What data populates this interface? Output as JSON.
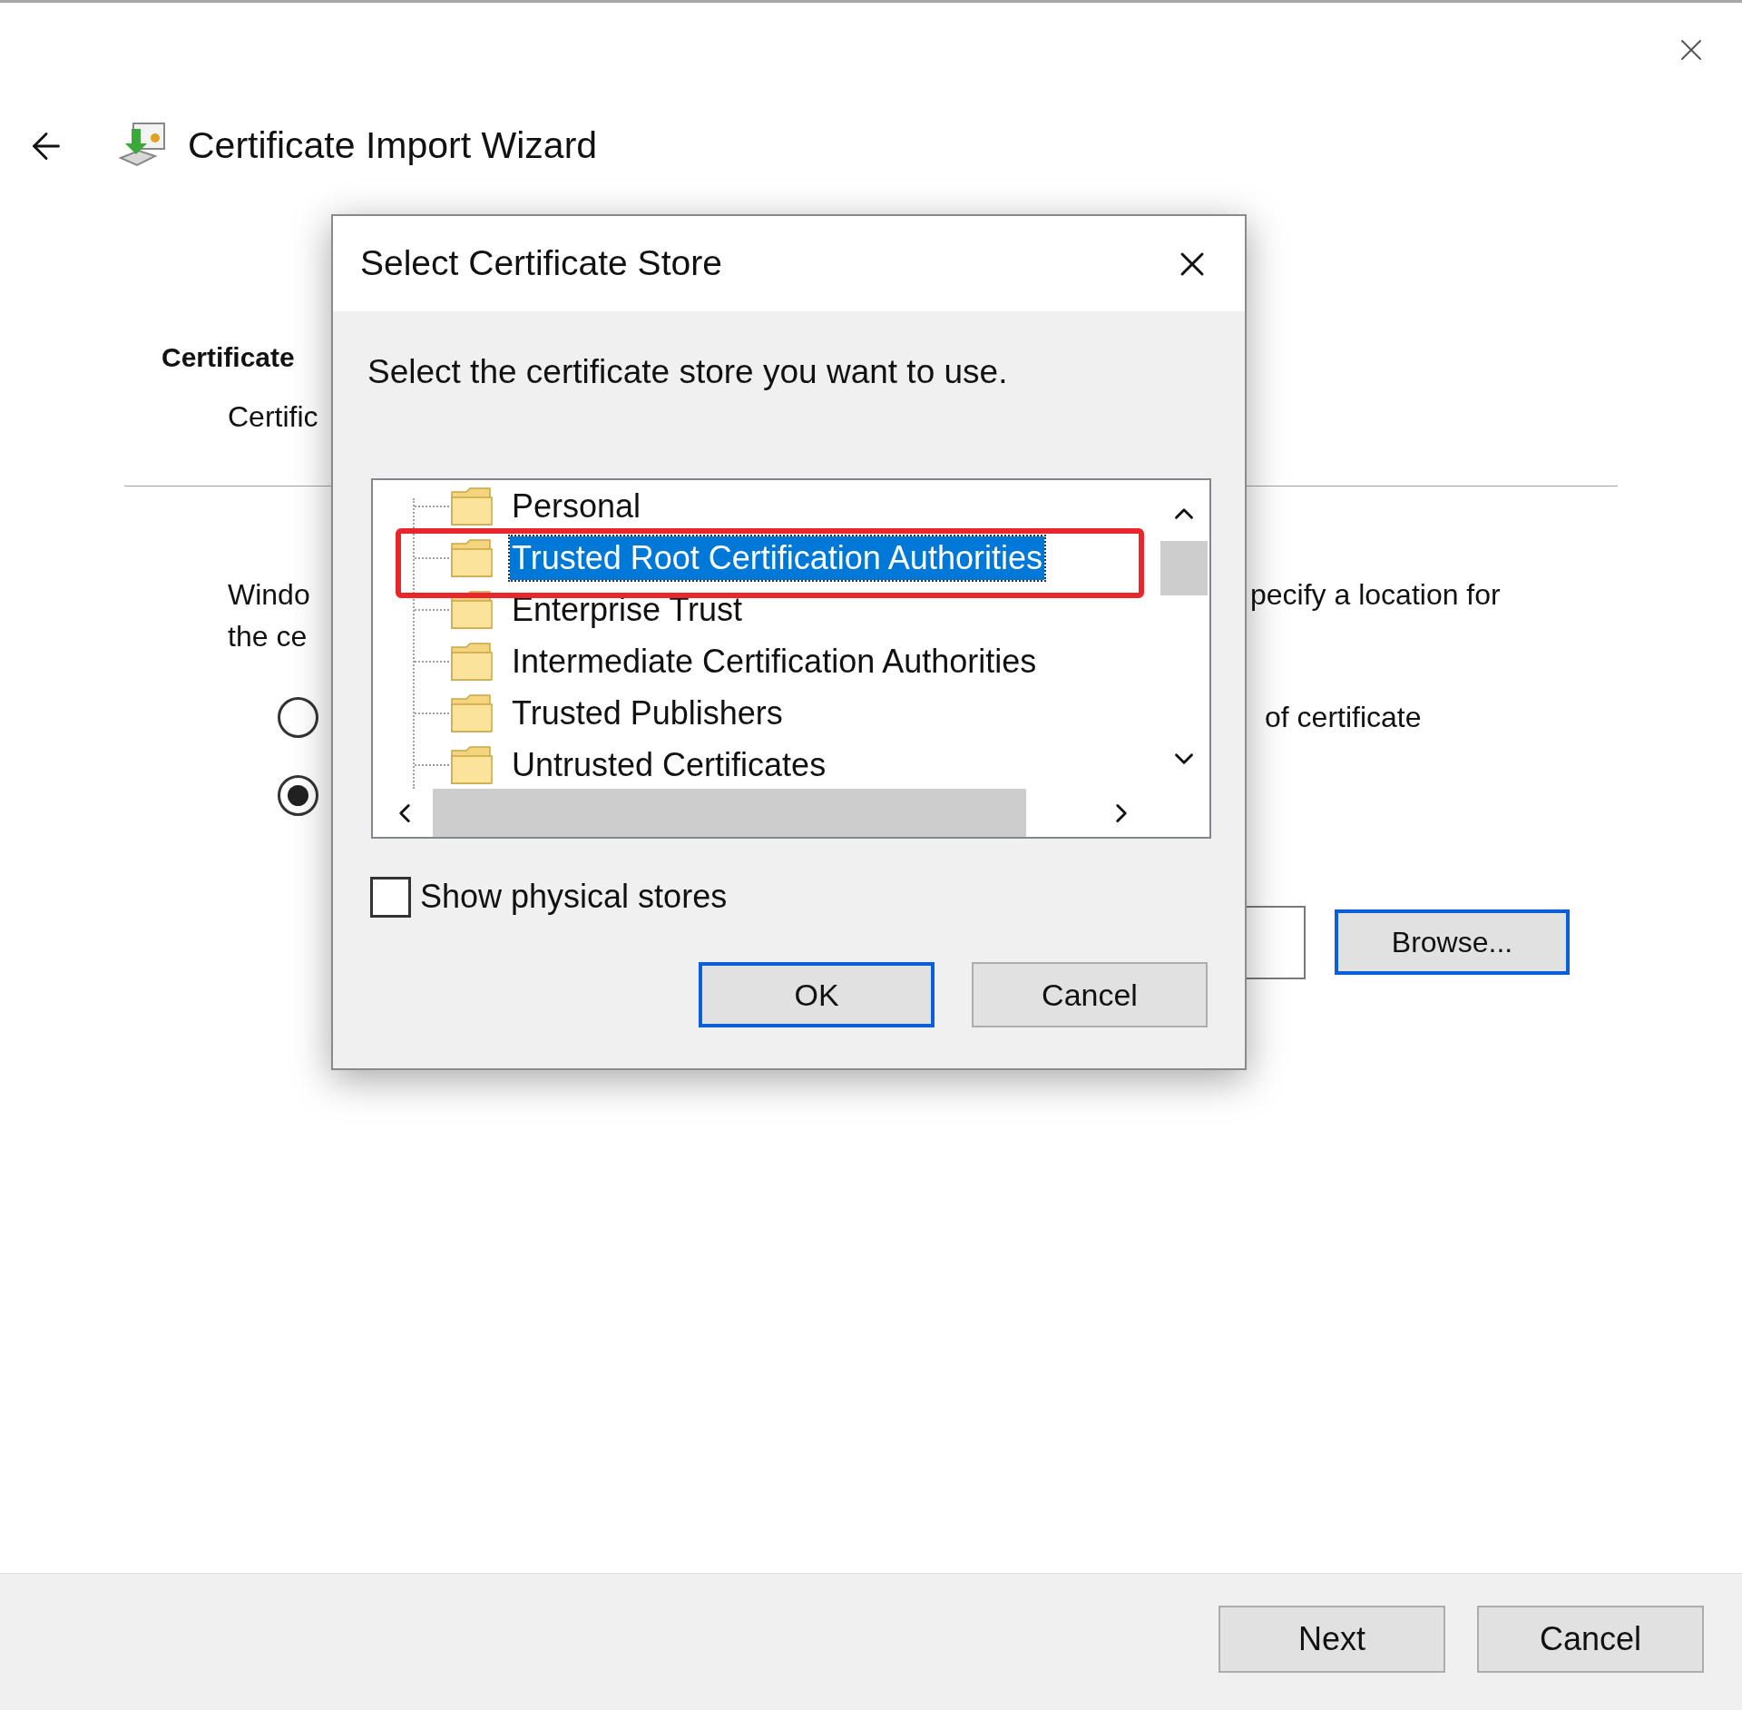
{
  "wizard": {
    "title": "Certificate Import Wizard",
    "heading_fragment": "Certificate",
    "subheading_fragment": "Certific",
    "paragraph_rows": [
      {
        "left": "Windo",
        "right": "pecify a location for"
      },
      {
        "left": "the ce"
      }
    ],
    "radios": [
      {
        "selected": false,
        "label_fragment": "of certificate"
      },
      {
        "selected": true
      }
    ],
    "browse_button": "Browse...",
    "footer_buttons": [
      "Next",
      "Cancel"
    ]
  },
  "dialog": {
    "title": "Select Certificate Store",
    "instruction": "Select the certificate store you want to use.",
    "stores": [
      {
        "label": "Personal",
        "selected": false
      },
      {
        "label": "Trusted Root Certification Authorities",
        "selected": true
      },
      {
        "label": "Enterprise Trust",
        "selected": false
      },
      {
        "label": "Intermediate Certification Authorities",
        "selected": false
      },
      {
        "label": "Trusted Publishers",
        "selected": false
      },
      {
        "label": "Untrusted Certificates",
        "selected": false
      }
    ],
    "show_physical_stores": {
      "label": "Show physical stores",
      "checked": false
    },
    "buttons": [
      {
        "label": "OK",
        "focused": true
      },
      {
        "label": "Cancel",
        "focused": false
      }
    ]
  }
}
